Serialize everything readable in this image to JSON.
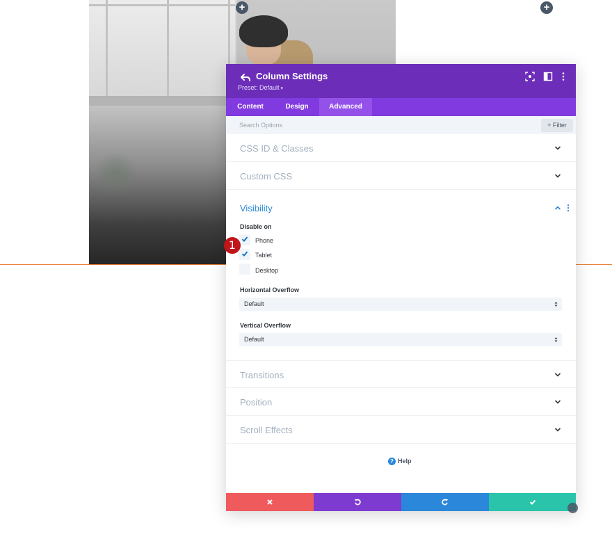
{
  "panel": {
    "title": "Column Settings",
    "preset": "Preset: Default",
    "tabs": [
      {
        "label": "Content"
      },
      {
        "label": "Design"
      },
      {
        "label": "Advanced",
        "active": true
      }
    ],
    "search": {
      "placeholder": "Search Options"
    },
    "filter_label": "Filter",
    "sections": {
      "css_id": "CSS ID & Classes",
      "custom_css": "Custom CSS",
      "visibility": "Visibility",
      "transitions": "Transitions",
      "position": "Position",
      "scroll_effects": "Scroll Effects"
    },
    "visibility": {
      "disable_on_label": "Disable on",
      "options": [
        {
          "label": "Phone",
          "checked": true
        },
        {
          "label": "Tablet",
          "checked": true
        },
        {
          "label": "Desktop",
          "checked": false
        }
      ],
      "horizontal_overflow": {
        "label": "Horizontal Overflow",
        "value": "Default"
      },
      "vertical_overflow": {
        "label": "Vertical Overflow",
        "value": "Default"
      }
    },
    "help_label": "Help"
  },
  "annotation": {
    "number": "1"
  },
  "colors": {
    "header": "#6c2eb9",
    "tabs": "#8139e0",
    "cancel": "#ef5a5d",
    "undo": "#7e3bd0",
    "redo": "#2b87da",
    "save": "#29c4a9",
    "accent_blue": "#2b87da",
    "check": "#0c71c3",
    "annotation": "#c0151b"
  },
  "icons": {
    "header": [
      "back-icon",
      "focus-icon",
      "split-view-icon",
      "more-icon"
    ],
    "footer": [
      "close-icon",
      "undo-icon",
      "redo-icon",
      "check-icon"
    ]
  }
}
